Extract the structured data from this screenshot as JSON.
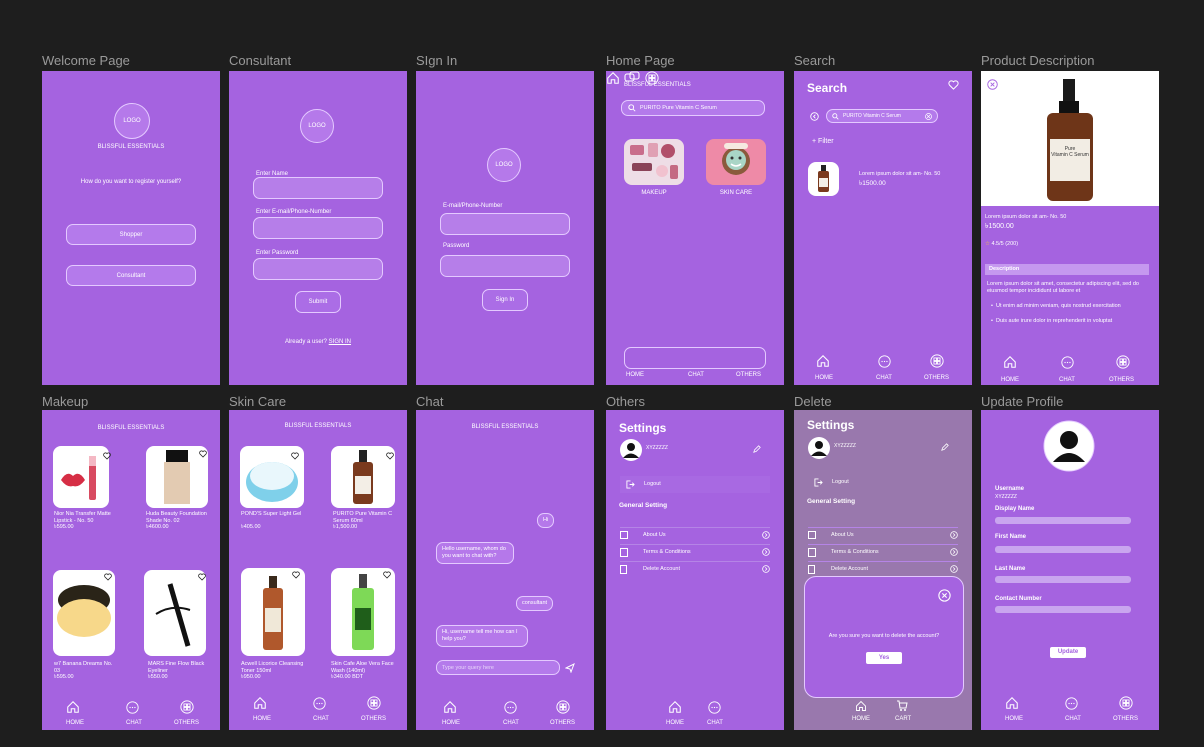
{
  "titles": {
    "welcome": "Welcome Page",
    "consultant": "Consultant",
    "signin": "SIgn In",
    "home": "Home Page",
    "search": "Search",
    "product": "Product Description",
    "makeup": "Makeup",
    "skincare": "Skin Care",
    "chat": "Chat",
    "others": "Others",
    "delete": "Delete",
    "update": "Update Profile"
  },
  "brand": "BLISSFUL ESSENTIALS",
  "logo": "LOGO",
  "welcome": {
    "question": "How do you want to register yourself?",
    "shopper": "Shopper",
    "consultant": "Consultant"
  },
  "consultant": {
    "name": "Enter Name",
    "email": "Enter E-mail/Phone-Number",
    "password": "Enter Password",
    "submit": "Submit",
    "already": "Already a user?",
    "signin_link": "SIGN IN"
  },
  "signin": {
    "email": "E-mail/Phone-Number",
    "password": "Password",
    "button": "Sign In"
  },
  "home": {
    "search": "PURITO Pure Vitamin C Serum",
    "cat1": "MAKEUP",
    "cat2": "SKIN CARE"
  },
  "nav": {
    "home": "HOME",
    "chat": "CHAT",
    "others": "OTHERS",
    "cart": "CART"
  },
  "search": {
    "heading": "Search",
    "query": "PURITO Vitamin C Serum",
    "filter": "Filter",
    "result_name": "Lorem ipsum dolor sit am- No. 50",
    "result_price": "৳1500.00"
  },
  "product": {
    "label_line1": "Pure",
    "label_line2": "Vitamin C Serum",
    "name": "Lorem ipsum dolor sit am- No. 50",
    "price": "৳1500.00",
    "rating": "4.5/5 (200)",
    "desc_heading": "Description",
    "desc": "Lorem ipsum dolor sit amet, consectetur adipiscing elit, sed do eiusmod tempor incididunt ut labore et",
    "bullet1": "Ut enim ad minim veniam, quis nostrud exercitation",
    "bullet2": "Duis aute irure dolor in reprehenderit in voluptat"
  },
  "makeup": [
    {
      "name": "Nior Nia Transfer Matte Lipstick - No. 50",
      "price": "৳595.00"
    },
    {
      "name": "Huda Beauty Foundation Shade No. 02",
      "price": "৳4600.00"
    },
    {
      "name": "w7 Banana Dreams No. 03",
      "price": "৳595.00"
    },
    {
      "name": "MARS Fine Flow Black Eyeliner",
      "price": "৳550.00"
    }
  ],
  "skincare": [
    {
      "name": "POND'S Super Light Gel",
      "price": "৳405.00"
    },
    {
      "name": "PURITO Pure Vitamin C Serum 60ml",
      "price": "৳1,500.00"
    },
    {
      "name": "Acwell Licorice Cleansing Toner 150ml",
      "price": "৳950.00"
    },
    {
      "name": "Skin Cafe Aloe Vera Face Wash (140ml)",
      "price": "৳340.00 BDT"
    }
  ],
  "chat": {
    "hi": "Hi",
    "msg1": "Hello username, whom do you want to chat with?",
    "consultant": "consultant",
    "msg2": "Hi, username tell me how can I help you?",
    "placeholder": "Type your query here"
  },
  "settings": {
    "heading": "Settings",
    "user": "XYZZZZZ",
    "logout": "Logout",
    "general": "General Setting",
    "about": "About Us",
    "terms": "Terms & Conditions",
    "delete": "Delete Account"
  },
  "delete_modal": {
    "question": "Are you sure you want to delete the account?",
    "yes": "Yes"
  },
  "profile": {
    "username_label": "Username",
    "username": "XYZZZZZ",
    "display": "Display Name",
    "first": "First Name",
    "last": "Last Name",
    "contact": "Contact Number",
    "update": "Update"
  },
  "colors": {
    "bg": "#1e1e1e",
    "frame": "#a563e0",
    "accent": "#e4c9ff"
  }
}
